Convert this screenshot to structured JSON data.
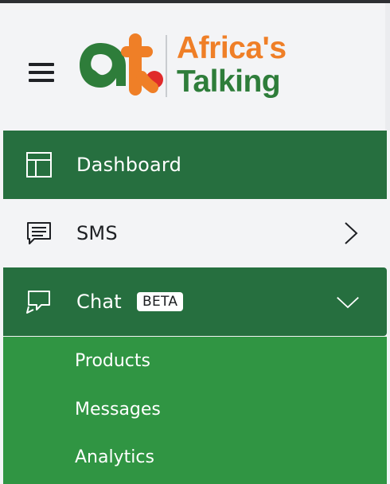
{
  "brand": {
    "name_line1": "Africa's",
    "name_line2": "Talking",
    "colors": {
      "orange": "#ef7f27",
      "green": "#2e7d3a"
    }
  },
  "menu_icon": "hamburger-menu-icon",
  "nav": {
    "items": [
      {
        "label": "Dashboard",
        "icon": "dashboard-layout-icon",
        "state": "active"
      },
      {
        "label": "SMS",
        "icon": "sms-message-icon",
        "state": "collapsed"
      },
      {
        "label": "Chat",
        "badge": "BETA",
        "icon": "chat-bubbles-icon",
        "state": "expanded"
      }
    ],
    "chat_submenu": [
      "Products",
      "Messages",
      "Analytics"
    ]
  },
  "colors": {
    "active_bg": "#266f3f",
    "submenu_bg": "#309543",
    "header_bg": "#f3f4f6"
  }
}
